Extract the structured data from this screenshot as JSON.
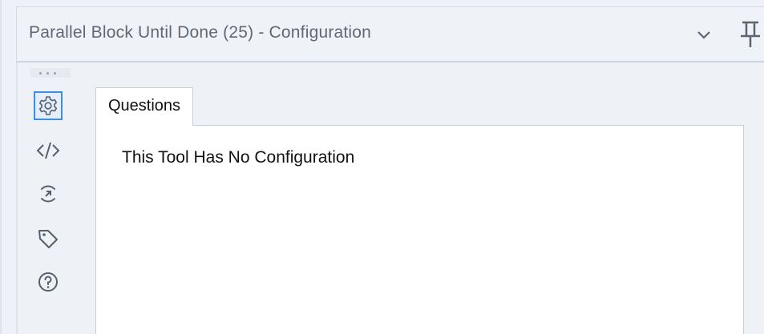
{
  "window": {
    "title": "Parallel Block Until Done (25) - Configuration"
  },
  "sidebar": {
    "icons": [
      "gear-icon",
      "code-icon",
      "fast-forward-icon",
      "tag-icon",
      "help-icon"
    ],
    "selected": "gear-icon"
  },
  "tabs": [
    {
      "label": "Questions"
    }
  ],
  "content": {
    "message": "This Tool Has No Configuration"
  },
  "colors": {
    "accent": "#3e8de0",
    "icon": "#56606d",
    "panel_bg": "#eef1f5"
  }
}
